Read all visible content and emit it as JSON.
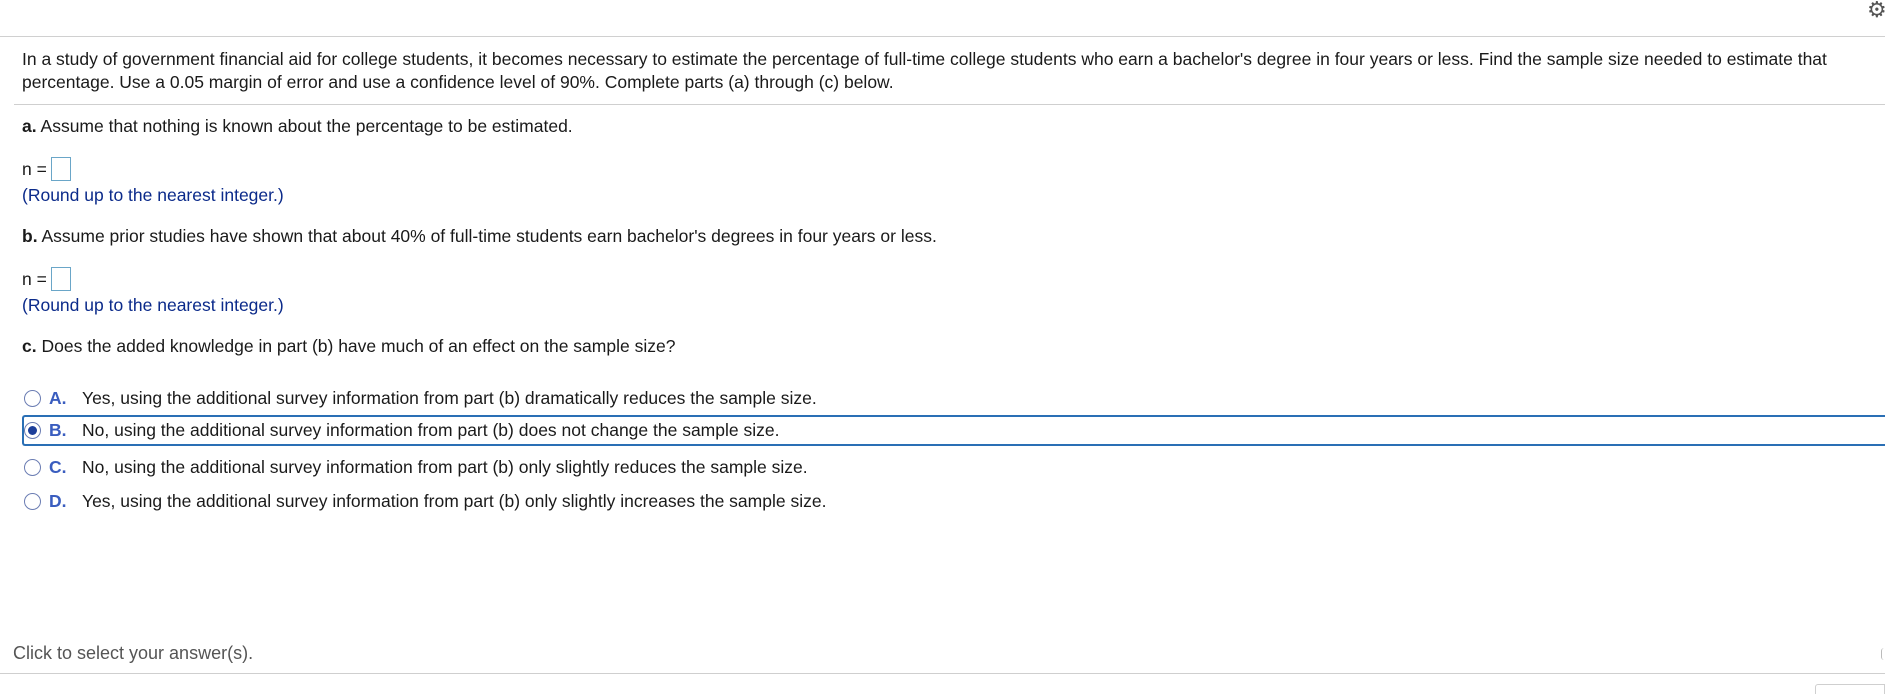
{
  "header": {
    "settings_icon": "gear-icon"
  },
  "question": {
    "intro": "In a study of government financial aid for college students, it becomes necessary to estimate the percentage of full-time college students who earn a bachelor's degree in four years or less. Find the sample size needed to estimate that percentage. Use a 0.05 margin of error and use a confidence level of 90%. Complete parts (a) through (c) below."
  },
  "part_a": {
    "letter": "a.",
    "text": "Assume that nothing is known about the percentage to be estimated.",
    "n_label": "n =",
    "answer_value": "",
    "hint": "(Round up to the nearest integer.)"
  },
  "part_b": {
    "letter": "b.",
    "text": "Assume prior studies have shown that about 40% of full-time students earn bachelor's degrees in four years or less.",
    "n_label": "n =",
    "answer_value": "",
    "hint": "(Round up to the nearest integer.)"
  },
  "part_c": {
    "letter": "c.",
    "text": "Does the added knowledge in part (b) have much of an effect on the sample size?",
    "selected": "B",
    "options": [
      {
        "letter": "A.",
        "text": "Yes, using the additional survey information from part (b) dramatically reduces the sample size."
      },
      {
        "letter": "B.",
        "text": "No, using the additional survey information from part (b) does not change the sample size."
      },
      {
        "letter": "C.",
        "text": "No, using the additional survey information from part (b) only slightly reduces the sample size."
      },
      {
        "letter": "D.",
        "text": "Yes, using the additional survey information from part (b) only slightly increases the sample size."
      }
    ]
  },
  "footer": {
    "status_text": "Click to select your answer(s)."
  },
  "colors": {
    "option_letter": "#3a5dbf",
    "hint_text": "#0b2a8a",
    "selected_border": "#2a6fb5",
    "radio_fill": "#1d3f9a"
  }
}
